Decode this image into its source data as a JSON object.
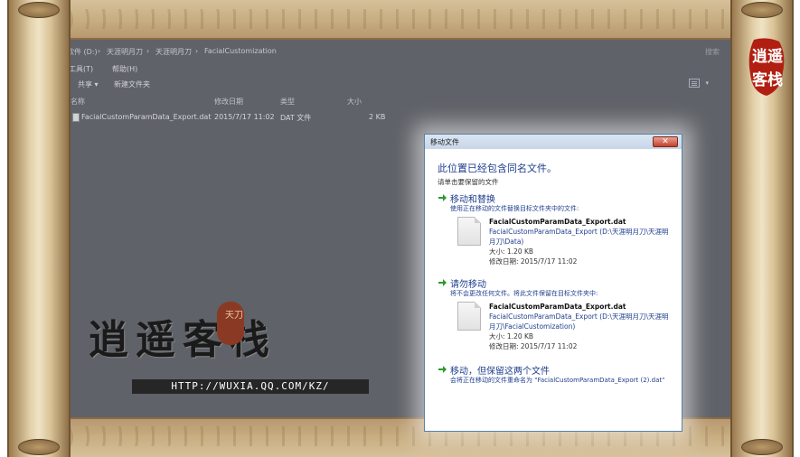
{
  "explorer": {
    "address": [
      "软件 (D:)",
      "天涯明月刀",
      "天涯明月刀",
      "FacialCustomization"
    ],
    "search_placeholder": "搜索",
    "menu": [
      "工具(T)",
      "帮助(H)"
    ],
    "toolbar": [
      "共享 ▾",
      "新建文件夹"
    ],
    "columns": [
      "名称",
      "修改日期",
      "类型",
      "大小"
    ],
    "files": [
      {
        "name": "FacialCustomParamData_Export.dat",
        "modified": "2015/7/17 11:02",
        "type": "DAT 文件",
        "size": "2 KB"
      }
    ]
  },
  "dialog": {
    "title": "移动文件",
    "close_glyph": "✕",
    "heading": "此位置已经包含同名文件。",
    "subheading": "请单击要保留的文件",
    "options": [
      {
        "title": "移动和替换",
        "desc": "使用正在移动的文件替换目标文件夹中的文件:",
        "file_name": "FacialCustomParamData_Export.dat",
        "file_path": "FacialCustomParamData_Export (D:\\天涯明月刀\\天涯明月刀\\Data)",
        "size": "大小: 1.20 KB",
        "modified": "修改日期: 2015/7/17 11:02"
      },
      {
        "title": "请勿移动",
        "desc": "将不会更改任何文件。将此文件保留在目标文件夹中:",
        "file_name": "FacialCustomParamData_Export.dat",
        "file_path": "FacialCustomParamData_Export (D:\\天涯明月刀\\天涯明月刀\\FacialCustomization)",
        "size": "大小: 1.20 KB",
        "modified": "修改日期: 2015/7/17 11:02"
      },
      {
        "title": "移动，但保留这两个文件",
        "desc": "会将正在移动的文件重命名为 \"FacialCustomParamData_Export (2).dat\""
      }
    ]
  },
  "watermark": {
    "name": "逍遥客栈",
    "seal": "天刀",
    "url": "HTTP://WUXIA.QQ.COM/KZ/"
  },
  "stamp": "逍遥客栈",
  "colors": {
    "accent_blue": "#1e3e8e",
    "green_arrow": "#2d9a2d",
    "explorer_overlay": "#5f6268"
  }
}
